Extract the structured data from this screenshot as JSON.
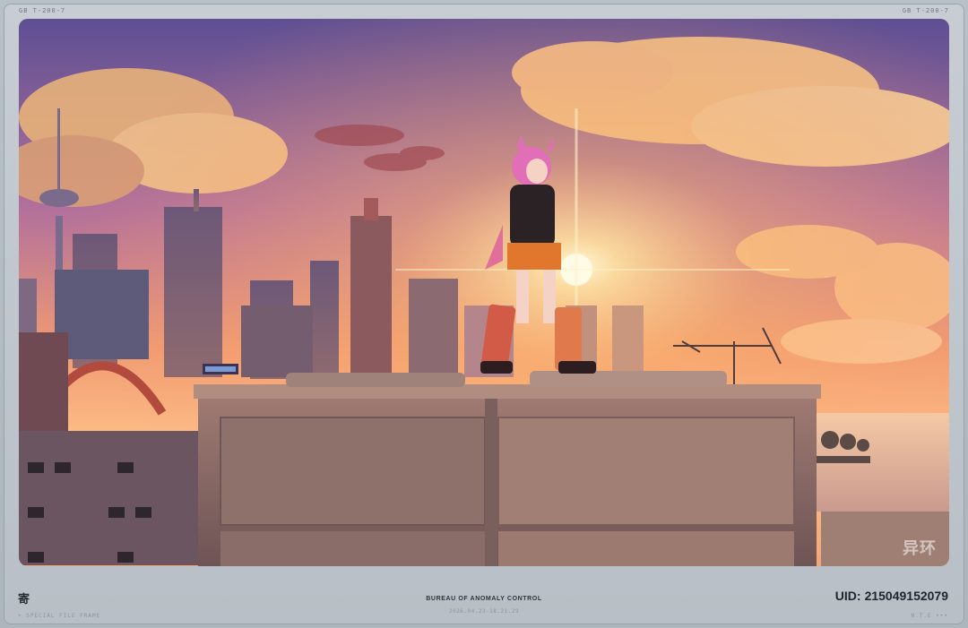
{
  "frame": {
    "corner_left": "GB  T-200-7",
    "corner_right": "GB  T-200-7"
  },
  "photo": {
    "watermark": "异环",
    "description_icons": [
      "sun-icon",
      "tv-antenna-icon",
      "billboard-icon"
    ]
  },
  "footer": {
    "stamp_glyph": "寄",
    "title": "BUREAU OF ANOMALY CONTROL",
    "date": "2026.04.23-18.21.29",
    "uid_label": "UID:",
    "uid_value": "215049152079",
    "left_note": "• SPECIAL FILE FRAME",
    "right_note": "N.T.E •••"
  },
  "colors": {
    "sky_top": "#6b5a9e",
    "sky_glow": "#ffb35c",
    "sun": "#fff4c8",
    "rooftop": "#8f6f6a",
    "frame": "#bfc6cd"
  }
}
